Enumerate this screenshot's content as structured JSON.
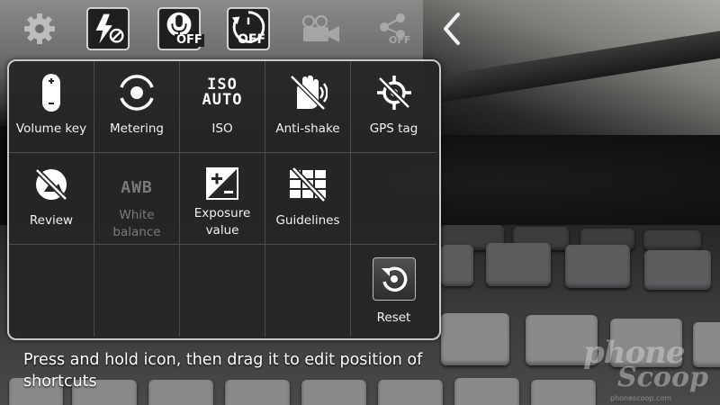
{
  "toolbar": {
    "settings_icon": "gear-icon",
    "flash_icon": "flash-off-icon",
    "voice_control": {
      "icon": "microphone-icon",
      "badge": "OFF"
    },
    "timer": {
      "icon": "timer-icon",
      "badge": "OFF"
    },
    "recording_icon": "video-camera-icon",
    "share": {
      "icon": "share-icon",
      "badge": "OFF"
    },
    "back_icon": "chevron-left-icon"
  },
  "settings_panel": {
    "items": [
      {
        "label": "Volume key",
        "icon": "volume-key-icon"
      },
      {
        "label": "Metering",
        "icon": "metering-icon"
      },
      {
        "label": "ISO",
        "icon": "iso-auto-icon",
        "icon_text_top": "ISO",
        "icon_text_bottom": "AUTO"
      },
      {
        "label": "Anti-shake",
        "icon": "anti-shake-icon"
      },
      {
        "label": "GPS tag",
        "icon": "gps-off-icon"
      },
      {
        "label": "Review",
        "icon": "review-off-icon"
      },
      {
        "label": "White\nbalance",
        "icon": "awb-icon",
        "icon_text": "AWB",
        "disabled": true
      },
      {
        "label": "Exposure\nvalue",
        "icon": "exposure-value-icon"
      },
      {
        "label": "Guidelines",
        "icon": "guidelines-off-icon"
      },
      {
        "label": "Reset",
        "icon": "reset-icon"
      }
    ]
  },
  "hint": "Press and hold icon, then drag it to edit position of shortcuts",
  "watermark": {
    "line1": "phone",
    "line2": "Scoop",
    "line3": "phonescoop.com"
  },
  "colors": {
    "panel_bg": "#262626",
    "panel_border": "#c9c9c9",
    "text": "#f2f2f2",
    "disabled_text": "#7a7a7a"
  }
}
